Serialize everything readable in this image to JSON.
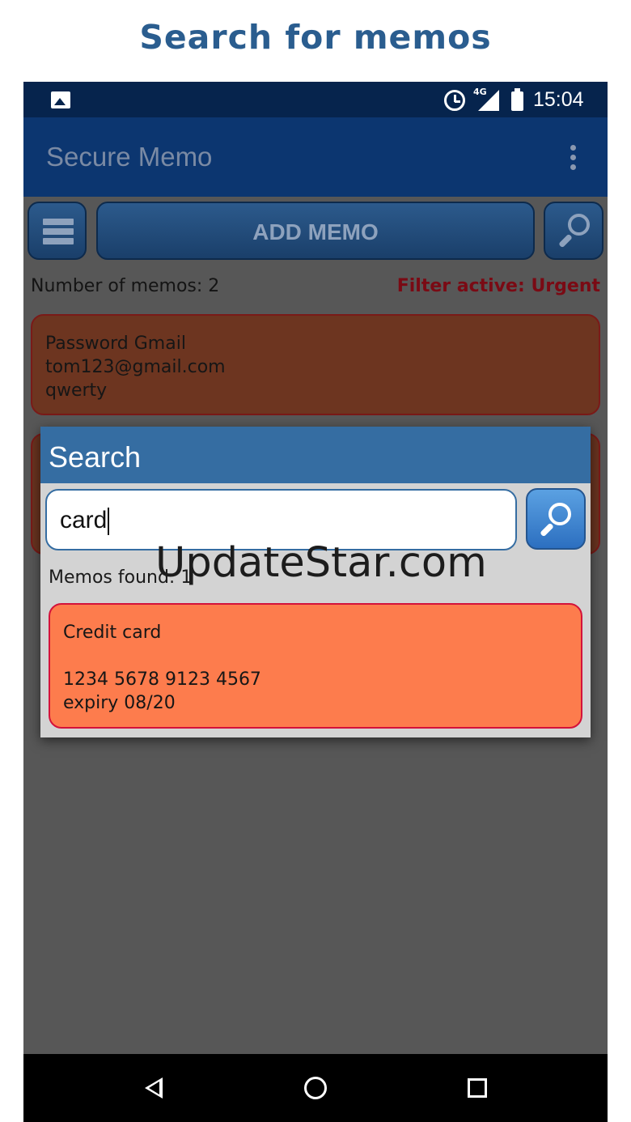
{
  "caption": "Search for memos",
  "status_bar": {
    "network": "4G",
    "time": "15:04",
    "icons": [
      "gallery-icon",
      "alarm-icon",
      "signal-icon",
      "battery-icon"
    ]
  },
  "app_bar": {
    "title": "Secure Memo",
    "overflow_icon": "more-vert-icon"
  },
  "toolbar": {
    "menu_icon": "hamburger-menu-icon",
    "add_label": "ADD MEMO",
    "search_icon": "search-icon"
  },
  "list": {
    "count_text": "Number of memos: 2",
    "filter_text": "Filter active: Urgent",
    "memos": [
      {
        "lines": [
          "Password Gmail",
          "tom123@gmail.com",
          "qwerty"
        ]
      }
    ]
  },
  "dialog": {
    "title": "Search",
    "search_value": "card",
    "search_button_icon": "search-icon",
    "found_text": "Memos found: 1",
    "results": [
      {
        "lines": [
          "Credit card",
          "",
          "1234 5678 9123 4567",
          "expiry 08/20"
        ]
      }
    ]
  },
  "watermark": "UpdateStar.com",
  "nav_bar": {
    "icons": [
      "back-icon",
      "home-icon",
      "recents-icon"
    ]
  },
  "colors": {
    "caption": "#2a5d8f",
    "status_bar": "#06244d",
    "app_bar": "#0c3670",
    "dialog_header": "#356da2",
    "filter_text": "#7a0a14",
    "result_card": "#fd7c4d",
    "result_border": "#d4123a"
  }
}
